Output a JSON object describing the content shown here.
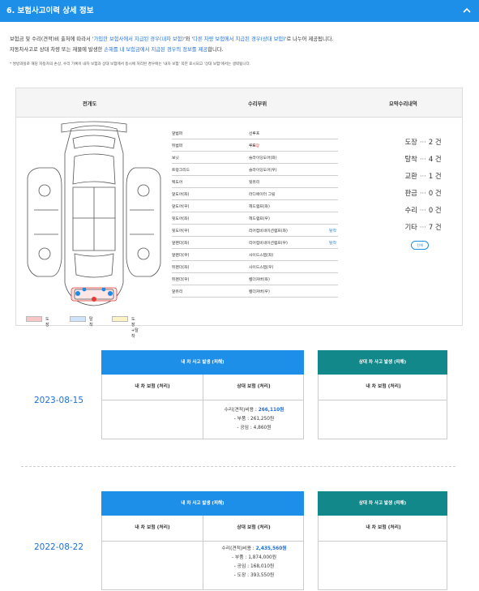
{
  "header": {
    "title": "6. 보험사고이력 상세 정보",
    "chevron_icon": "chevron-up-icon"
  },
  "intro": {
    "line1_a": "보험금 및 수리(견적)비 출처에 따라서 '",
    "line1_b": "가입한 보험사에서 지급된 경우(내차 보험)",
    "line1_c": "'와 '",
    "line1_d": "다른 차량 보험에서 지급된 경우(상대 보험)",
    "line1_e": "'로 나누어 제공됩니다.",
    "line2_a": "자동차사고로 상대 차량 또는 재물에 발생한 ",
    "line2_b": "손해를 내 보험금에서 지급된 경우의 정보를 제공",
    "line2_c": "합니다.",
    "note": "* 쌍방과실로 해당 자동차의 손상, 수리 기록이 내차 보험과 상대 보험에서 동시에 처리된 경우에는 '내차 보험' 쪽만 표시되고 '상대 보험'에서는 생략됩니다."
  },
  "damage_panel": {
    "col_diagram": "전개도",
    "col_parts": "수리부위",
    "col_summary": "요약수리내역",
    "parts_left": [
      {
        "name": "앞범퍼",
        "tag": ""
      },
      {
        "name": "뒤범퍼",
        "tag": "도장",
        "tag_color": "red"
      },
      {
        "name": "보닛",
        "tag": ""
      },
      {
        "name": "트렁크리드",
        "tag": ""
      },
      {
        "name": "백도어",
        "tag": ""
      },
      {
        "name": "앞도어(좌)",
        "tag": ""
      },
      {
        "name": "앞도어(우)",
        "tag": ""
      },
      {
        "name": "뒷도어(좌)",
        "tag": ""
      },
      {
        "name": "뒷도어(우)",
        "tag": ""
      },
      {
        "name": "앞펜더(좌)",
        "tag": ""
      },
      {
        "name": "앞펜더(우)",
        "tag": ""
      },
      {
        "name": "뒤펜더(좌)",
        "tag": ""
      },
      {
        "name": "뒤펜더(우)",
        "tag": ""
      },
      {
        "name": "앞유리",
        "tag": ""
      }
    ],
    "parts_right": [
      {
        "name": "선루프",
        "tag": ""
      },
      {
        "name": "루프",
        "tag": ""
      },
      {
        "name": "슬라이딩도어(좌)",
        "tag": ""
      },
      {
        "name": "슬라이딩도어(우)",
        "tag": ""
      },
      {
        "name": "뒷유리",
        "tag": ""
      },
      {
        "name": "라디에이터 그릴",
        "tag": ""
      },
      {
        "name": "헤드램프(좌)",
        "tag": ""
      },
      {
        "name": "헤드램프(우)",
        "tag": ""
      },
      {
        "name": "리어컴비네이션램프(좌)",
        "tag": "탈착",
        "tag_color": "blue"
      },
      {
        "name": "리어컴비네이션램프(우)",
        "tag": "탈착",
        "tag_color": "blue"
      },
      {
        "name": "사이드스텝(좌)",
        "tag": ""
      },
      {
        "name": "사이드스텝(우)",
        "tag": ""
      },
      {
        "name": "휀더커버(좌)",
        "tag": ""
      },
      {
        "name": "휀더커버(우)",
        "tag": ""
      }
    ],
    "summary": [
      {
        "label": "도장",
        "count": "2 건"
      },
      {
        "label": "탈착",
        "count": "4 건"
      },
      {
        "label": "교환",
        "count": "1 건"
      },
      {
        "label": "판금",
        "count": "0 건"
      },
      {
        "label": "수리",
        "count": "0 건"
      },
      {
        "label": "기타",
        "count": "7 건"
      }
    ],
    "summary_sep": "···",
    "detail_button": "전체",
    "legend": [
      {
        "label": "도장",
        "color": "#f7c6c6"
      },
      {
        "label": "탈착",
        "color": "#cfe3fb"
      },
      {
        "label": "도장+탈착",
        "color": "#fbf3c4"
      }
    ]
  },
  "accidents": [
    {
      "date": "2023-08-15",
      "my_car_header": "내 차 사고 발생 (피해)",
      "other_car_header": "상대 차 사고 발생 (피해)",
      "col_my_ins": "내 차 보험 (처리)",
      "col_other_ins": "상대 보험 (처리)",
      "col_my_ins_2": "내 차 보험 (처리)",
      "cost_label": "수리(견적)비용 : ",
      "cost_amount": "266,110원",
      "lines": [
        "- 부품 : 261,250원",
        "- 공임 : 4,860원"
      ]
    },
    {
      "date": "2022-08-22",
      "my_car_header": "내 차 사고 발생 (피해)",
      "other_car_header": "상대 차 사고 발생 (피해)",
      "col_my_ins": "내 차 보험 (처리)",
      "col_other_ins": "상대 보험 (처리)",
      "col_my_ins_2": "내 차 보험 (처리)",
      "cost_label": "수리(견적)비용 : ",
      "cost_amount": "2,435,560원",
      "lines": [
        "- 부품 : 1,874,000원",
        "- 공임 : 168,010원",
        "- 도장 : 393,550원"
      ]
    }
  ],
  "colors": {
    "header_blue": "#1e8fe8",
    "accent_green": "#12888a",
    "link_blue": "#1e6fd9",
    "tag_red": "#e53935"
  }
}
